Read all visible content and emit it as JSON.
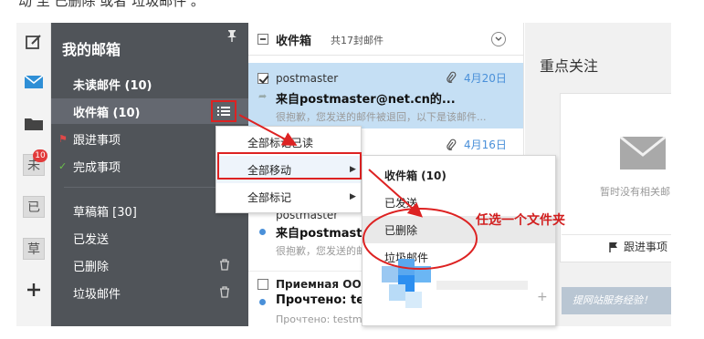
{
  "instruction_text": "动 至 已删除 或者 垃圾邮件 。",
  "rail": {
    "items": [
      {
        "name": "compose-icon"
      },
      {
        "name": "mail-icon"
      },
      {
        "name": "folder-icon"
      },
      {
        "name": "contact-char",
        "char": "未",
        "badge": "10"
      },
      {
        "name": "sent-char",
        "char": "已"
      },
      {
        "name": "draft-char",
        "char": "草"
      },
      {
        "name": "add-icon"
      }
    ]
  },
  "sidebar": {
    "title": "我的邮箱",
    "items": [
      {
        "label": "未读邮件 (10)"
      },
      {
        "label": "收件箱 (10)"
      },
      {
        "label": "跟进事项"
      },
      {
        "label": "完成事项"
      },
      {
        "label": "草稿箱 [30]"
      },
      {
        "label": "已发送"
      },
      {
        "label": "已删除"
      },
      {
        "label": "垃圾邮件"
      }
    ]
  },
  "mail_list": {
    "title": "收件箱",
    "count": "共17封邮件",
    "mails": [
      {
        "sender": "postmaster",
        "subject": "来自postmaster@net.cn的...",
        "preview": "很抱歉，您发送的邮件被退回，以下是该邮件...",
        "date": "4月20日"
      },
      {
        "date": "4月16日"
      },
      {
        "sender": "postmaster",
        "subject": "来自postmaster",
        "preview": "很抱歉，您发送的邮"
      },
      {
        "sender": "Приемная ООО",
        "subject": "Прочтено: te",
        "preview": "Прочтено: testm"
      }
    ]
  },
  "right_panel": {
    "title": "重点关注",
    "empty_message": "暂时没有相关邮",
    "follow_label": "跟进事项",
    "footer_text": "提网站服务经验！"
  },
  "menu_level1": {
    "items": [
      {
        "label": "全部标记已读"
      },
      {
        "label": "全部移动"
      },
      {
        "label": "全部标记"
      }
    ]
  },
  "menu_level2": {
    "items": [
      {
        "label": "收件箱 (10)"
      },
      {
        "label": "已发送"
      },
      {
        "label": "已删除"
      },
      {
        "label": "垃圾邮件"
      }
    ]
  },
  "annotation": "任选一个文件夹",
  "colors": {
    "sidebar_bg": "#505459",
    "selected_mail": "#c5dff4",
    "accent_blue": "#4a90d9",
    "annotation_red": "#d21e1e"
  }
}
